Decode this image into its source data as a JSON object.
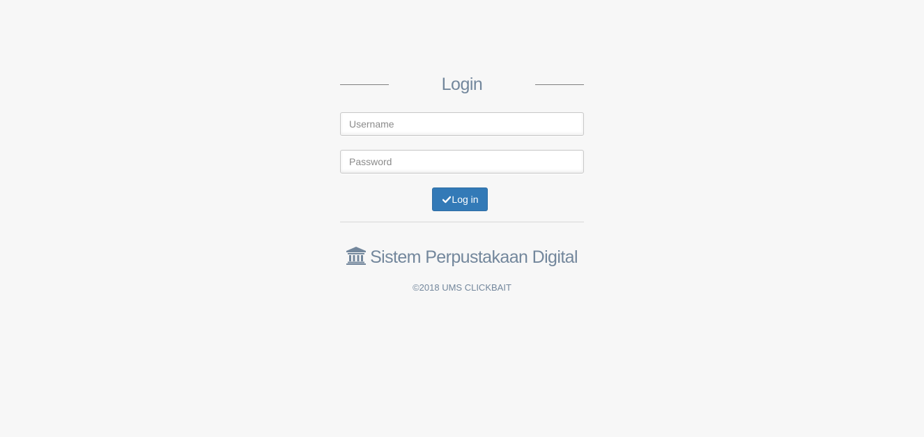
{
  "login": {
    "title": "Login",
    "username_placeholder": "Username",
    "password_placeholder": "Password",
    "submit_label": "Log in",
    "submit_icon": "check-icon"
  },
  "brand": {
    "icon": "bank-icon",
    "name": "Sistem Perpustakaan Digital",
    "copyright": "©2018 UMS CLICKBAIT"
  },
  "colors": {
    "background": "#f7f7f7",
    "text_muted": "#73879c",
    "primary": "#337ab7"
  }
}
